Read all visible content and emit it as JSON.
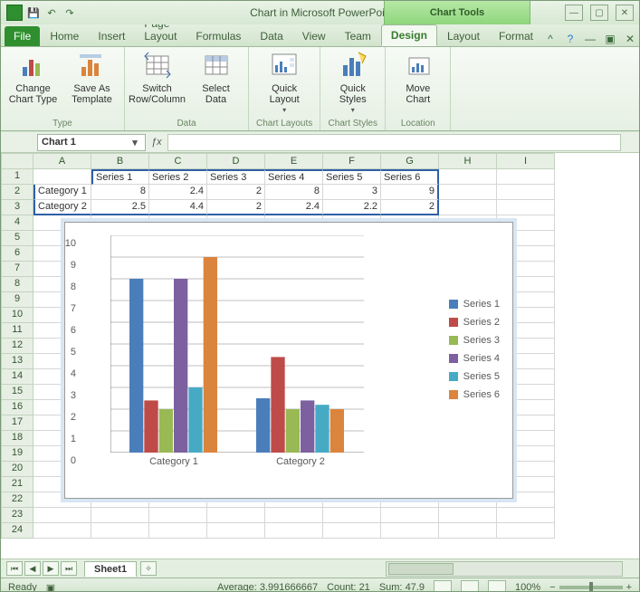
{
  "window": {
    "title": "Chart in Microsoft PowerPoint.xlsx - Micro...",
    "contextual": "Chart Tools"
  },
  "qat": {
    "save": "💾",
    "undo": "↶",
    "redo": "↷"
  },
  "tabs": {
    "file": "File",
    "list": [
      "Home",
      "Insert",
      "Page Layout",
      "Formulas",
      "Data",
      "View",
      "Team",
      "Design",
      "Layout",
      "Format"
    ],
    "active": "Design"
  },
  "ribbon": {
    "groups": [
      {
        "label": "Type",
        "items": [
          {
            "id": "change-chart-type",
            "label": "Change Chart Type"
          },
          {
            "id": "save-as-template",
            "label": "Save As Template"
          }
        ]
      },
      {
        "label": "Data",
        "items": [
          {
            "id": "switch-row-column",
            "label": "Switch Row/Column"
          },
          {
            "id": "select-data",
            "label": "Select Data"
          }
        ]
      },
      {
        "label": "Chart Layouts",
        "items": [
          {
            "id": "quick-layout",
            "label": "Quick Layout",
            "dd": true
          }
        ]
      },
      {
        "label": "Chart Styles",
        "items": [
          {
            "id": "quick-styles",
            "label": "Quick Styles",
            "dd": true
          }
        ]
      },
      {
        "label": "Location",
        "items": [
          {
            "id": "move-chart",
            "label": "Move Chart"
          }
        ]
      }
    ]
  },
  "namebox": "Chart 1",
  "columns": [
    "A",
    "B",
    "C",
    "D",
    "E",
    "F",
    "G",
    "H",
    "I"
  ],
  "grid": {
    "headers": [
      "",
      "Series 1",
      "Series 2",
      "Series 3",
      "Series 4",
      "Series 5",
      "Series 6"
    ],
    "rows": [
      {
        "label": "Category 1",
        "vals": [
          8,
          2.4,
          2,
          8,
          3,
          9
        ]
      },
      {
        "label": "Category 2",
        "vals": [
          2.5,
          4.4,
          2,
          2.4,
          2.2,
          2
        ]
      }
    ]
  },
  "chart_data": {
    "type": "bar",
    "categories": [
      "Category 1",
      "Category 2"
    ],
    "series": [
      {
        "name": "Series 1",
        "values": [
          8,
          2.5
        ],
        "color": "#4a7ebb"
      },
      {
        "name": "Series 2",
        "values": [
          2.4,
          4.4
        ],
        "color": "#be4b48"
      },
      {
        "name": "Series 3",
        "values": [
          2,
          2
        ],
        "color": "#98b954"
      },
      {
        "name": "Series 4",
        "values": [
          8,
          2.4
        ],
        "color": "#7d60a0"
      },
      {
        "name": "Series 5",
        "values": [
          3,
          2.2
        ],
        "color": "#46aac5"
      },
      {
        "name": "Series 6",
        "values": [
          9,
          2
        ],
        "color": "#db843d"
      }
    ],
    "ylim": [
      0,
      10
    ],
    "yticks": [
      0,
      1,
      2,
      3,
      4,
      5,
      6,
      7,
      8,
      9,
      10
    ],
    "title": "",
    "xlabel": "",
    "ylabel": ""
  },
  "sheettab": "Sheet1",
  "status": {
    "ready": "Ready",
    "average_label": "Average:",
    "average": "3.991666667",
    "count_label": "Count:",
    "count": "21",
    "sum_label": "Sum:",
    "sum": "47.9",
    "zoom": "100%"
  }
}
